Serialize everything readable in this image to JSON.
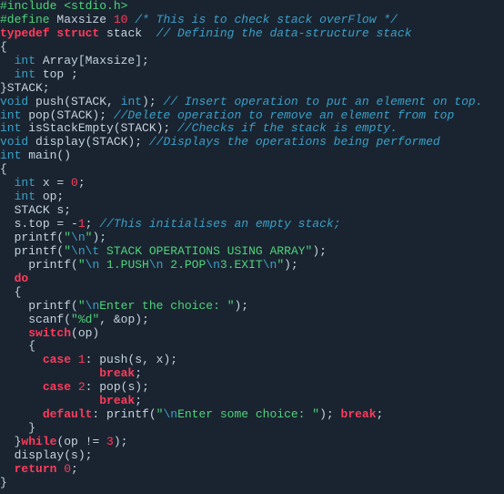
{
  "code": {
    "l1": {
      "pp": "#include ",
      "inc": "<stdio.h>"
    },
    "l2": {
      "pp": "#define ",
      "mac": "Maxsize ",
      "num": "10",
      "cmt": " /* This is to check stack overFlow */"
    },
    "l3": {
      "kw1": "typedef",
      "sp1": " ",
      "kw2": "struct",
      "sp2": " ",
      "id": "stack  ",
      "cmt": "// Defining the data-structure stack"
    },
    "l4": {
      "t": "{"
    },
    "l5": {
      "pad": "  ",
      "type": "int",
      "t": " Array[Maxsize];"
    },
    "l6": {
      "pad": "  ",
      "type": "int",
      "t": " top ;"
    },
    "l7": {
      "t": "}STACK;"
    },
    "l8": {
      "type": "void",
      "t": " push(STACK, ",
      "type2": "int",
      "t2": "); ",
      "cmt": "// Insert operation to put an element on top."
    },
    "l9": {
      "type": "int",
      "t": " pop(STACK); ",
      "cmt": "//Delete operation to remove an element from top"
    },
    "l10": {
      "type": "int",
      "t": " isStackEmpty(STACK); ",
      "cmt": "//Checks if the stack is empty."
    },
    "l11": {
      "type": "void",
      "t": " display(STACK); ",
      "cmt": "//Displays the operations being performed"
    },
    "l12": {
      "type": "int",
      "t": " main()"
    },
    "l13": {
      "t": "{"
    },
    "l14": {
      "pad": "  ",
      "type": "int",
      "t": " x = ",
      "num": "0",
      "t2": ";"
    },
    "l15": {
      "pad": "  ",
      "type": "int",
      "t": " op;"
    },
    "l16": {
      "pad": "  ",
      "t": "STACK s;"
    },
    "l17": {
      "pad": "  ",
      "t": "s.top = -",
      "num": "1",
      "t2": "; ",
      "cmt": "//This initialises an empty stack;"
    },
    "l18": {
      "pad": "  ",
      "fn": "printf(",
      "q1": "\"",
      "e1": "\\n",
      "q2": "\"",
      "t": ");"
    },
    "l19": {
      "pad": "  ",
      "fn": "printf(",
      "q1": "\"",
      "e1": "\\n\\t",
      "s": " STACK OPERATIONS USING ARRAY",
      "q2": "\"",
      "t": ");"
    },
    "l20": {
      "pad": "    ",
      "fn": "printf(",
      "q1": "\"",
      "e1": "\\n",
      "s1": " 1.PUSH",
      "e2": "\\n",
      "s2": " 2.POP",
      "e3": "\\n",
      "s3": "3.EXIT",
      "e4": "\\n",
      "q2": "\"",
      "t": ");"
    },
    "l21": {
      "pad": "  ",
      "kw": "do"
    },
    "l22": {
      "pad": "  ",
      "t": "{"
    },
    "l23": {
      "pad": "    ",
      "fn": "printf(",
      "q1": "\"",
      "e1": "\\n",
      "s": "Enter the choice: ",
      "q2": "\"",
      "t": ");"
    },
    "l24": {
      "pad": "    ",
      "fn": "scanf(",
      "q1": "\"",
      "s": "%d",
      "q2": "\"",
      "t": ", &op);"
    },
    "l25": {
      "pad": "    ",
      "kw": "switch",
      "t": "(op)"
    },
    "l26": {
      "pad": "    ",
      "t": "{"
    },
    "l27": {
      "pad": "      ",
      "kw": "case",
      "sp": " ",
      "num": "1",
      "t": ": push(s, x);"
    },
    "l28": {
      "pad": "              ",
      "kw": "break",
      "t": ";"
    },
    "l29": {
      "pad": "      ",
      "kw": "case",
      "sp": " ",
      "num": "2",
      "t": ": pop(s);"
    },
    "l30": {
      "pad": "              ",
      "kw": "break",
      "t": ";"
    },
    "l31": {
      "pad": "      ",
      "kw": "default",
      "t": ": printf(",
      "q1": "\"",
      "e1": "\\n",
      "s": "Enter some choice: ",
      "q2": "\"",
      "t2": "); ",
      "kw2": "break",
      "t3": ";"
    },
    "l32": {
      "pad": "    ",
      "t": "}"
    },
    "l33": {
      "pad": "  ",
      "t": "}",
      "kw": "while",
      "t2": "(op != ",
      "num": "3",
      "t3": ");"
    },
    "l34": {
      "pad": "  ",
      "t": "display(s);"
    },
    "l35": {
      "pad": "  ",
      "kw": "return",
      "sp": " ",
      "num": "0",
      "t": ";"
    },
    "l36": {
      "t": "}"
    }
  }
}
